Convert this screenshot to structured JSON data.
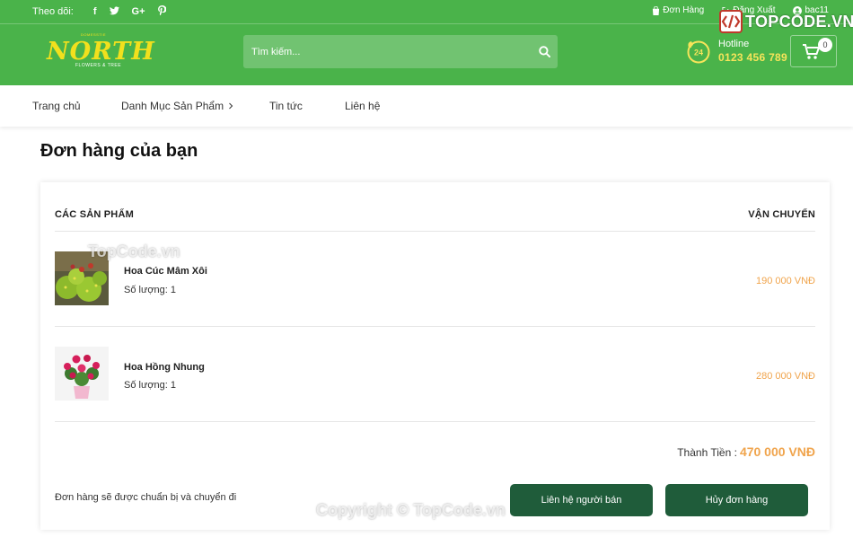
{
  "topbar": {
    "follow_label": "Theo dõi:",
    "social": [
      {
        "icon": "facebook-icon",
        "glyph": "f"
      },
      {
        "icon": "twitter-icon",
        "glyph": "t"
      },
      {
        "icon": "google-plus-icon",
        "glyph": "G+"
      },
      {
        "icon": "pinterest-icon",
        "glyph": "p"
      }
    ],
    "orders_link": "Đơn Hàng",
    "logout_link": "Đăng Xuất",
    "user_name": "bac11"
  },
  "logo": {
    "brand": "NORTH",
    "arc": "DOMESSTIE",
    "tagline": "FLOWERS & TREE"
  },
  "search": {
    "placeholder": "Tìm kiếm..."
  },
  "hotline": {
    "label": "Hotline",
    "number": "0123 456 789",
    "badge": "24"
  },
  "cart": {
    "count": "0"
  },
  "nav": {
    "home": "Trang chủ",
    "categories": "Danh Mục Sản Phẩm",
    "news": "Tin tức",
    "contact": "Liên hệ"
  },
  "page": {
    "title": "Đơn hàng của bạn"
  },
  "order": {
    "col_products": "CÁC SẢN PHẨM",
    "col_shipping": "VẬN CHUYỂN",
    "qty_label": "Số lượng:",
    "items": [
      {
        "name": "Hoa Cúc Mâm Xôi",
        "qty": "1",
        "price": "190 000 VNĐ"
      },
      {
        "name": "Hoa Hồng Nhung",
        "qty": "1",
        "price": "280 000 VNĐ"
      }
    ],
    "total_label": "Thành Tiền :",
    "total_value": "470 000 VNĐ",
    "note": "Đơn hàng sẽ được chuẩn bị và chuyển đi",
    "contact_button": "Liên hệ người bán",
    "cancel_button": "Hủy đơn hàng"
  },
  "watermarks": {
    "top": "TopCode.vn",
    "bottom": "Copyright © TopCode.vn",
    "logo": "TOPCODE.VN"
  },
  "colors": {
    "header_green": "#4ab34a",
    "button_dark_green": "#1f5c3a",
    "price_orange": "#f0a44c",
    "logo_yellow": "#f2e01d"
  }
}
